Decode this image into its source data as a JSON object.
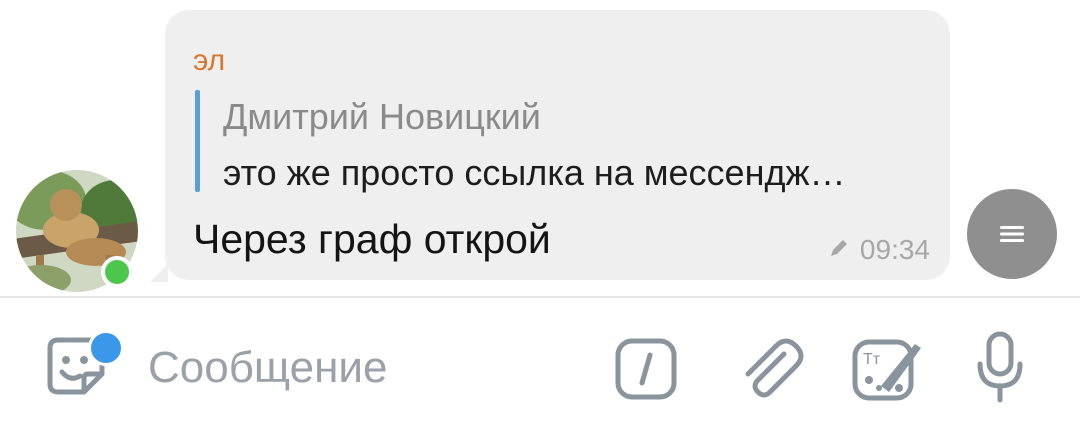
{
  "message": {
    "sender": "эл",
    "reply": {
      "author": "Дмитрий Новицкий",
      "text": "это же просто ссылка на мессендж…"
    },
    "text": "Через граф открой",
    "time": "09:34",
    "edited_icon": "pencil-icon"
  },
  "avatar": {
    "status_color": "#4cc74c"
  },
  "composer": {
    "placeholder": "Сообщение",
    "icons": [
      "sticker-icon",
      "command-icon",
      "paperclip-icon",
      "paint-icon",
      "microphone-icon"
    ]
  },
  "colors": {
    "sender": "#d9772a",
    "reply_bar": "#5a9fd8",
    "bubble": "#efefef",
    "icon": "#8a949d",
    "notification_dot": "#3b98e8"
  }
}
